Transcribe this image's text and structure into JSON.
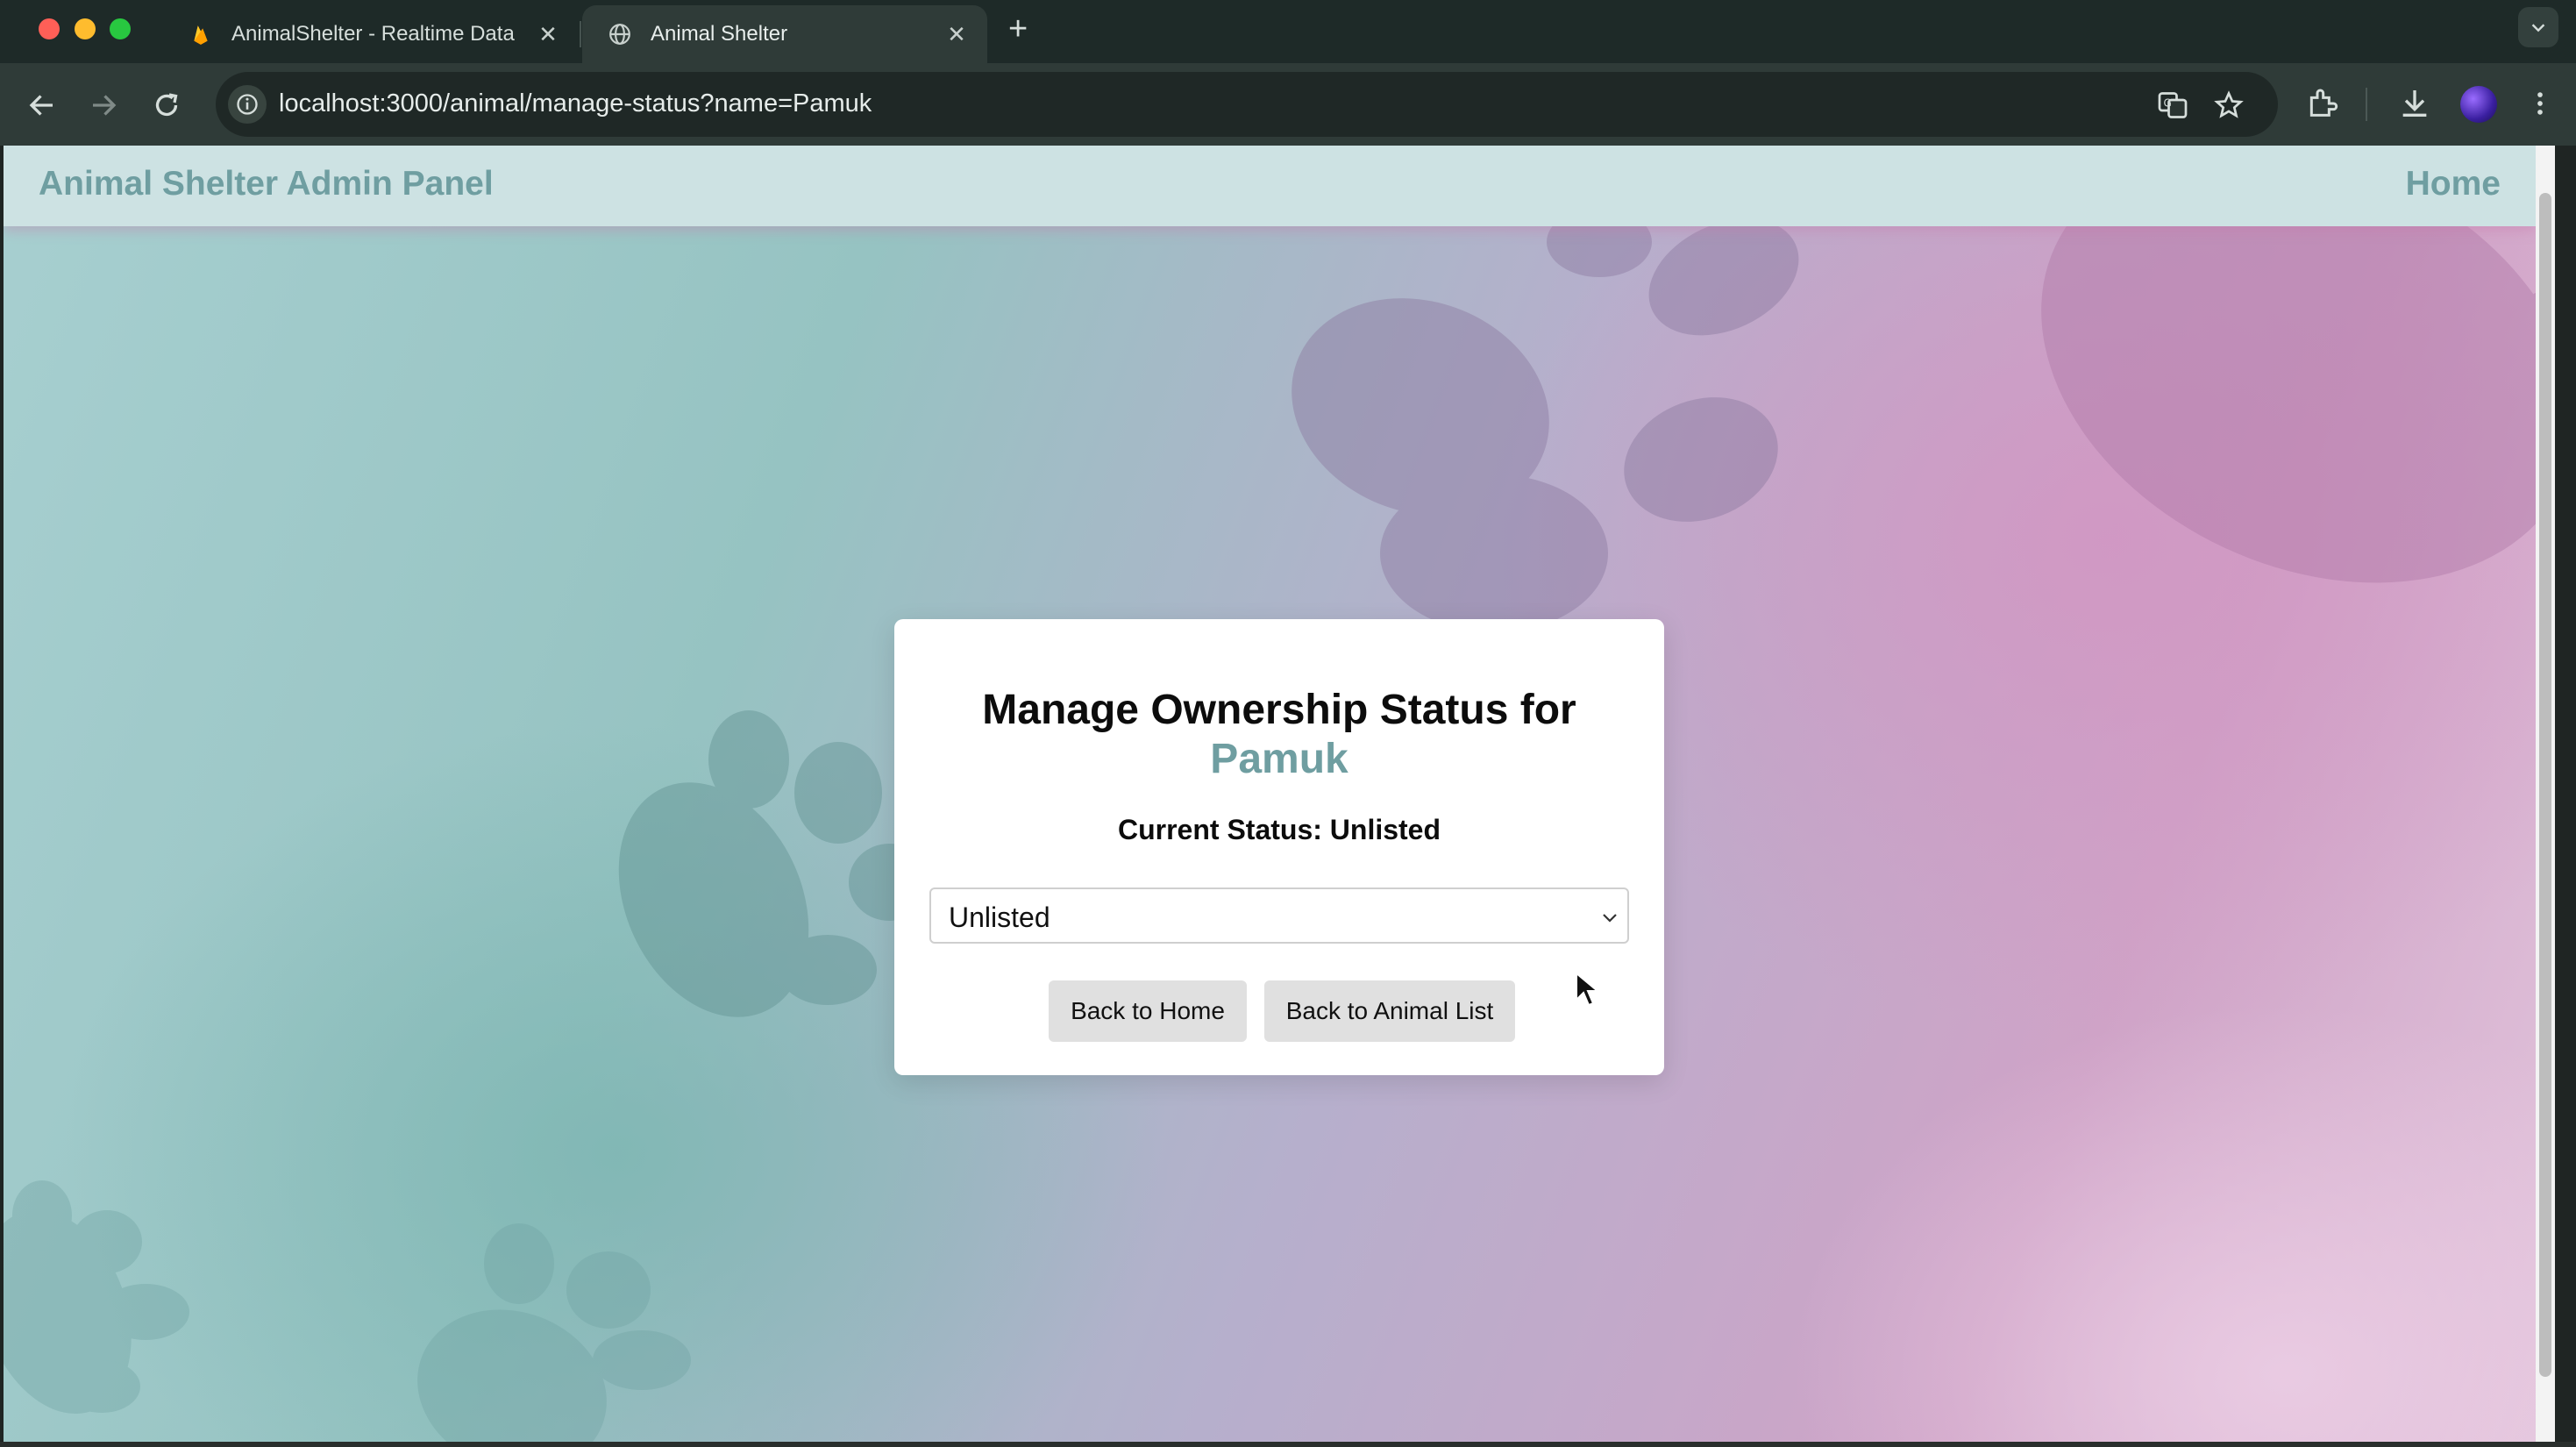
{
  "browser": {
    "tabs": [
      {
        "title": "AnimalShelter - Realtime Data",
        "icon": "firebase-flame-icon",
        "active": false
      },
      {
        "title": "Animal Shelter",
        "icon": "globe-icon",
        "active": true
      }
    ],
    "url": "localhost:3000/animal/manage-status?name=Pamuk"
  },
  "header": {
    "brand": "Animal Shelter Admin Panel",
    "home_link": "Home"
  },
  "card": {
    "title_prefix": "Manage Ownership Status for",
    "animal_name": "Pamuk",
    "current_status": "Current Status: Unlisted",
    "status_select": {
      "selected": "Unlisted"
    },
    "buttons": {
      "back_home": "Back to Home",
      "back_list": "Back to Animal List"
    }
  },
  "colors": {
    "accent": "#6f9ea1",
    "header_bg": "#cde2e3",
    "button_bg": "#e0e0e0"
  }
}
